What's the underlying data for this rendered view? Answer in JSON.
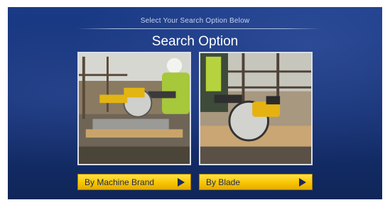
{
  "header": {
    "subtitle": "Select Your Search Option Below",
    "title": "Search Option"
  },
  "options": [
    {
      "label": "By Machine Brand",
      "image_desc": "miter-saw-photo",
      "arrow_icon": "play-arrow-icon"
    },
    {
      "label": "By Blade",
      "image_desc": "circular-saw-photo",
      "arrow_icon": "play-arrow-icon"
    }
  ],
  "colors": {
    "background": "#163173",
    "button": "#f8c600",
    "button_text": "#1c2a5a",
    "title_text": "#ffffff"
  }
}
